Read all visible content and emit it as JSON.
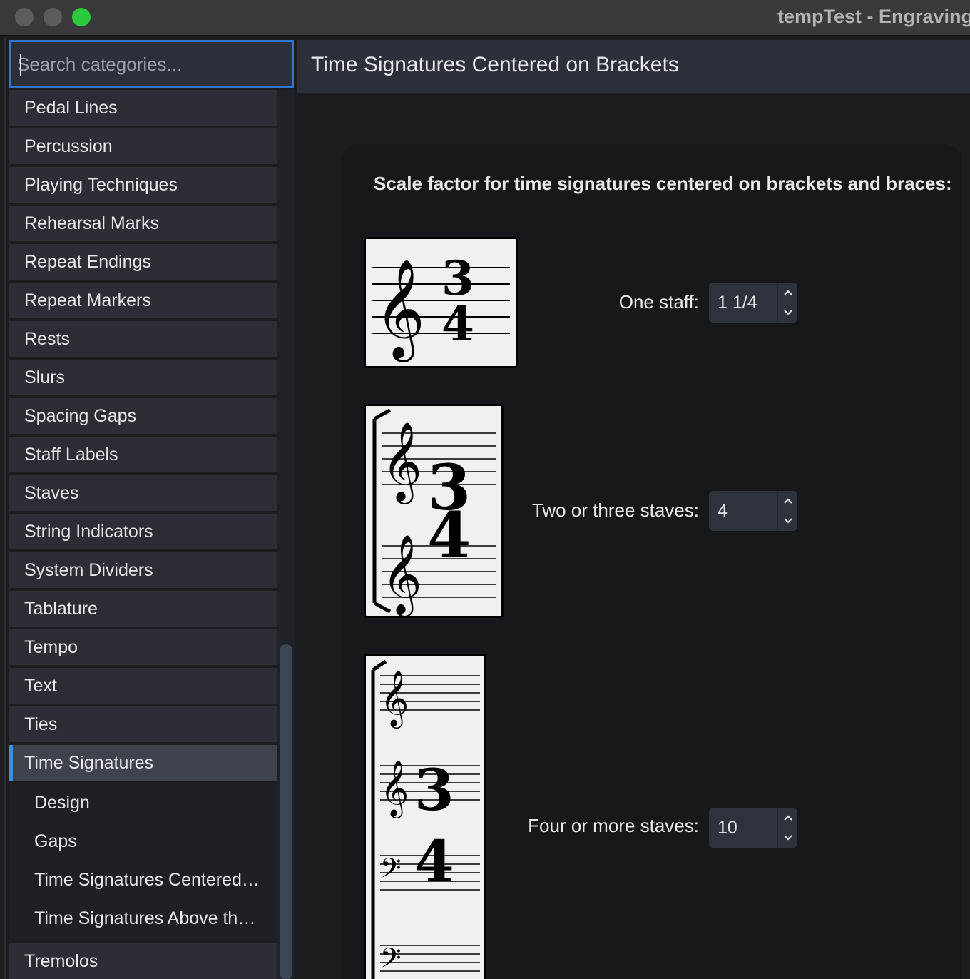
{
  "window": {
    "title": "tempTest - Engraving"
  },
  "sidebar": {
    "search_placeholder": "Search categories...",
    "items": [
      {
        "label": "Pedal Lines"
      },
      {
        "label": "Percussion"
      },
      {
        "label": "Playing Techniques"
      },
      {
        "label": "Rehearsal Marks"
      },
      {
        "label": "Repeat Endings"
      },
      {
        "label": "Repeat Markers"
      },
      {
        "label": "Rests"
      },
      {
        "label": "Slurs"
      },
      {
        "label": "Spacing Gaps"
      },
      {
        "label": "Staff Labels"
      },
      {
        "label": "Staves"
      },
      {
        "label": "String Indicators"
      },
      {
        "label": "System Dividers"
      },
      {
        "label": "Tablature"
      },
      {
        "label": "Tempo"
      },
      {
        "label": "Text"
      },
      {
        "label": "Ties"
      }
    ],
    "selected": {
      "label": "Time Signatures",
      "accent": "#3b8fe0",
      "children": [
        {
          "label": "Design"
        },
        {
          "label": "Gaps"
        },
        {
          "label": "Time Signatures Centered…"
        },
        {
          "label": "Time Signatures Above th…"
        }
      ]
    },
    "after_items": [
      {
        "label": "Tremolos"
      }
    ]
  },
  "main": {
    "title": "Time Signatures Centered on Brackets",
    "heading": "Scale factor for time signatures centered on brackets and braces:",
    "fields": [
      {
        "label": "One staff:",
        "value": "1 1/4",
        "preview_icon": "one-staff-time-signature-preview"
      },
      {
        "label": "Two or three staves:",
        "value": "4",
        "preview_icon": "two-staves-bracket-time-signature-preview"
      },
      {
        "label": "Four or more staves:",
        "value": "10",
        "preview_icon": "four-staves-bracket-time-signature-preview"
      }
    ],
    "time_signature": {
      "numerator": "3",
      "denominator": "4"
    }
  },
  "colors": {
    "accent": "#2f7ad0",
    "traffic_green": "#2bc840"
  }
}
